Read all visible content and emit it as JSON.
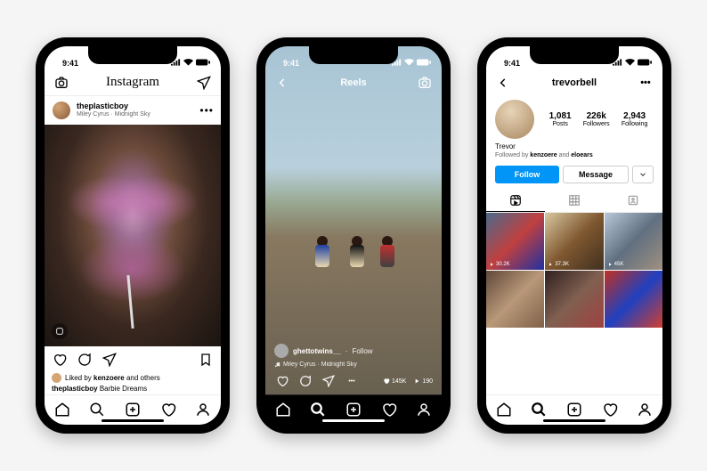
{
  "status": {
    "time": "9:41"
  },
  "phone1": {
    "header": {
      "logo": "Instagram"
    },
    "post": {
      "username": "theplasticboy",
      "music": "Miley Cyrus · Midnight Sky",
      "liked_by_prefix": "Liked by ",
      "liked_by_user": "kenzoere",
      "liked_by_suffix": " and others",
      "caption_user": "theplasticboy",
      "caption_text": "Barbie Dreams"
    }
  },
  "phone2": {
    "title": "Reels",
    "username": "ghettotwins__",
    "follow": "Follow",
    "music": "Miley Cyrus · Midnight Sky",
    "likes": "145K",
    "views": "190"
  },
  "phone3": {
    "handle": "trevorbell",
    "stats": {
      "posts_n": "1,081",
      "posts_l": "Posts",
      "followers_n": "226k",
      "followers_l": "Followers",
      "following_n": "2,943",
      "following_l": "Following"
    },
    "name": "Trevor",
    "followed_by_prefix": "Followed by ",
    "followed_by_1": "kenzoere",
    "followed_by_mid": " and ",
    "followed_by_2": "eloears",
    "follow_btn": "Follow",
    "message_btn": "Message",
    "grid": {
      "t1": "30.2K",
      "t2": "37.3K",
      "t3": "45K"
    }
  }
}
